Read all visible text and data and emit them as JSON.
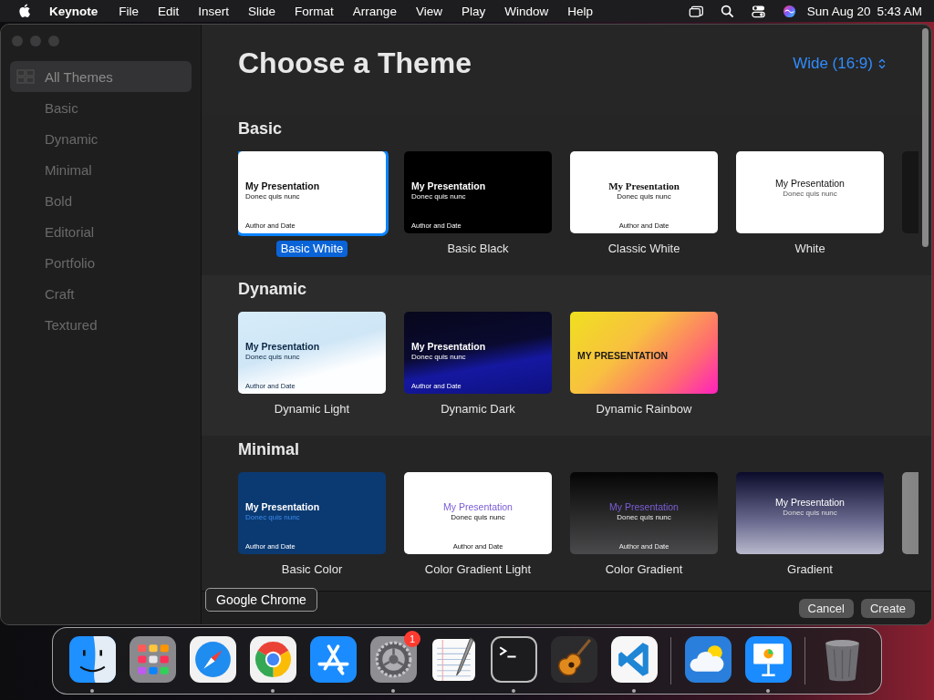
{
  "menu_bar": {
    "app_name": "Keynote",
    "menus": [
      "File",
      "Edit",
      "Insert",
      "Slide",
      "Format",
      "Arrange",
      "View",
      "Play",
      "Window",
      "Help"
    ],
    "date": "Sun Aug 20",
    "time": "5:43 AM"
  },
  "sidebar": {
    "items": [
      {
        "label": "All Themes",
        "selected": true
      },
      {
        "label": "Basic",
        "selected": false
      },
      {
        "label": "Dynamic",
        "selected": false
      },
      {
        "label": "Minimal",
        "selected": false
      },
      {
        "label": "Bold",
        "selected": false
      },
      {
        "label": "Editorial",
        "selected": false
      },
      {
        "label": "Portfolio",
        "selected": false
      },
      {
        "label": "Craft",
        "selected": false
      },
      {
        "label": "Textured",
        "selected": false
      }
    ]
  },
  "header": {
    "title": "Choose a Theme",
    "size_menu": "Wide (16:9)"
  },
  "sections": [
    {
      "title": "Basic",
      "themes": [
        {
          "name": "Basic White",
          "kind": "white",
          "selected": true,
          "slide": {
            "title": "My Presentation",
            "subtitle": "Donec quis nunc",
            "footer": "Author and Date"
          }
        },
        {
          "name": "Basic Black",
          "kind": "black",
          "selected": false,
          "slide": {
            "title": "My Presentation",
            "subtitle": "Donec quis nunc",
            "footer": "Author and Date"
          }
        },
        {
          "name": "Classic White",
          "kind": "classic",
          "selected": false,
          "slide": {
            "title": "My Presentation",
            "subtitle": "Donec quis nunc",
            "footer": "Author and Date"
          }
        },
        {
          "name": "White",
          "kind": "plain",
          "selected": false,
          "slide": {
            "title": "My Presentation",
            "subtitle": "Donec quis nunc"
          }
        },
        {
          "kind": "edge-dark",
          "selected": false
        }
      ]
    },
    {
      "title": "Dynamic",
      "themes": [
        {
          "name": "Dynamic Light",
          "kind": "light-wave",
          "selected": false,
          "slide": {
            "title": "My Presentation",
            "subtitle": "Donec quis nunc",
            "footer": "Author and Date"
          }
        },
        {
          "name": "Dynamic Dark",
          "kind": "dark-wave",
          "selected": false,
          "slide": {
            "title": "My Presentation",
            "subtitle": "Donec quis nunc",
            "footer": "Author and Date"
          }
        },
        {
          "name": "Dynamic Rainbow",
          "kind": "rainbow",
          "selected": false,
          "slide": {
            "title": "MY PRESENTATION"
          }
        }
      ]
    },
    {
      "title": "Minimal",
      "themes": [
        {
          "name": "Basic Color",
          "kind": "navy",
          "selected": false,
          "slide": {
            "title": "My Presentation",
            "subtitle": "Donec quis nunc",
            "footer": "Author and Date"
          }
        },
        {
          "name": "Color Gradient Light",
          "kind": "gradient-light",
          "selected": false,
          "slide": {
            "title": "My Presentation",
            "subtitle": "Donec quis nunc",
            "footer": "Author and Date"
          }
        },
        {
          "name": "Color Gradient",
          "kind": "gradient-dark",
          "selected": false,
          "slide": {
            "title": "My Presentation",
            "subtitle": "Donec quis nunc",
            "footer": "Author and Date"
          }
        },
        {
          "name": "Gradient",
          "kind": "gradient",
          "selected": false,
          "slide": {
            "title": "My Presentation",
            "subtitle": "Donec quis nunc"
          }
        },
        {
          "kind": "edge-grey",
          "selected": false
        }
      ]
    }
  ],
  "footer": {
    "buttons": [
      "Cancel",
      "Create"
    ]
  },
  "tooltip": "Google Chrome",
  "dock": {
    "items": [
      {
        "kind": "finder",
        "running": true
      },
      {
        "kind": "launchpad",
        "running": false
      },
      {
        "kind": "safari",
        "running": false
      },
      {
        "kind": "chrome",
        "running": true
      },
      {
        "kind": "appstore",
        "running": false
      },
      {
        "kind": "settings",
        "running": true,
        "badge": "1"
      },
      {
        "kind": "textedit",
        "running": false
      },
      {
        "kind": "terminal",
        "running": true
      },
      {
        "kind": "garageband",
        "running": false
      },
      {
        "kind": "vscode",
        "running": true
      },
      {
        "kind": "separator"
      },
      {
        "kind": "weather",
        "running": false
      },
      {
        "kind": "keynote",
        "running": true
      },
      {
        "kind": "separator"
      },
      {
        "kind": "trash",
        "running": false
      }
    ]
  }
}
